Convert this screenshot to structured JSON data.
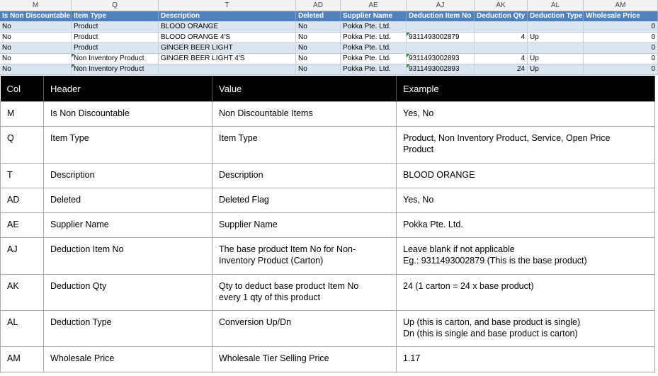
{
  "sheet": {
    "column_letters": [
      "M",
      "Q",
      "T",
      "AD",
      "AE",
      "AJ",
      "AK",
      "AL",
      "AM"
    ],
    "headers": [
      "Is Non Discountable",
      "Item Type",
      "Description",
      "Deleted",
      "Supplier Name",
      "Deduction Item No",
      "Deduction Qty",
      "Deduction Type",
      "Wholesale Price"
    ],
    "rows": [
      [
        "No",
        "Product",
        "BLOOD ORANGE",
        "No",
        "Pokka Pte. Ltd.",
        "",
        "",
        "",
        "0"
      ],
      [
        "No",
        "Product",
        "BLOOD ORANGE 4'S",
        "No",
        "Pokka Pte. Ltd.",
        "9311493002879",
        "4",
        "Up",
        "0"
      ],
      [
        "No",
        "Product",
        "GINGER BEER LIGHT",
        "No",
        "Pokka Pte. Ltd.",
        "",
        "",
        "",
        "0"
      ],
      [
        "No",
        "Non Inventory Product",
        "GINGER BEER LIGHT 4'S",
        "No",
        "Pokka Pte. Ltd.",
        "9311493002893",
        "4",
        "Up",
        "0"
      ],
      [
        "No",
        "Non Inventory Product",
        "",
        "No",
        "Pokka Pte. Ltd.",
        "9311493002893",
        "24",
        "Up",
        "0"
      ]
    ]
  },
  "reference": {
    "headers": [
      "Col",
      "Header",
      "Value",
      "Example"
    ],
    "rows": [
      {
        "col": "M",
        "header": "Is Non Discountable",
        "value": [
          "Non Discountable Items"
        ],
        "example": [
          "Yes, No"
        ]
      },
      {
        "col": "Q",
        "header": "Item Type",
        "value": [
          "Item Type"
        ],
        "example": [
          "Product, Non Inventory Product, Service, Open Price",
          "Product"
        ]
      },
      {
        "col": "T",
        "header": "Description",
        "value": [
          "Description"
        ],
        "example": [
          "BLOOD ORANGE"
        ]
      },
      {
        "col": "AD",
        "header": "Deleted",
        "value": [
          "Deleted Flag"
        ],
        "example": [
          "Yes, No"
        ]
      },
      {
        "col": "AE",
        "header": "Supplier Name",
        "value": [
          "Supplier Name"
        ],
        "example": [
          "Pokka Pte. Ltd."
        ]
      },
      {
        "col": "AJ",
        "header": "Deduction Item No",
        "value": [
          "The base product Item No for Non-",
          "Inventory Product (Carton)"
        ],
        "example": [
          "Leave blank if not applicable",
          "Eg.: 9311493002879  (This is the base product)"
        ]
      },
      {
        "col": "AK",
        "header": "Deduction Qty",
        "value": [
          "Qty to deduct base product Item No",
          "every 1 qty of this product"
        ],
        "example": [
          "24 (1 carton = 24 x base product)"
        ]
      },
      {
        "col": "AL",
        "header": "Deduction Type",
        "value": [
          "Conversion Up/Dn"
        ],
        "example": [
          "Up (this is carton, and base product is single)",
          "Dn (this is single and base product is carton)"
        ]
      },
      {
        "col": "AM",
        "header": "Wholesale Price",
        "value": [
          "Wholesale Tier Selling Price"
        ],
        "example": [
          "1.17"
        ]
      }
    ]
  }
}
